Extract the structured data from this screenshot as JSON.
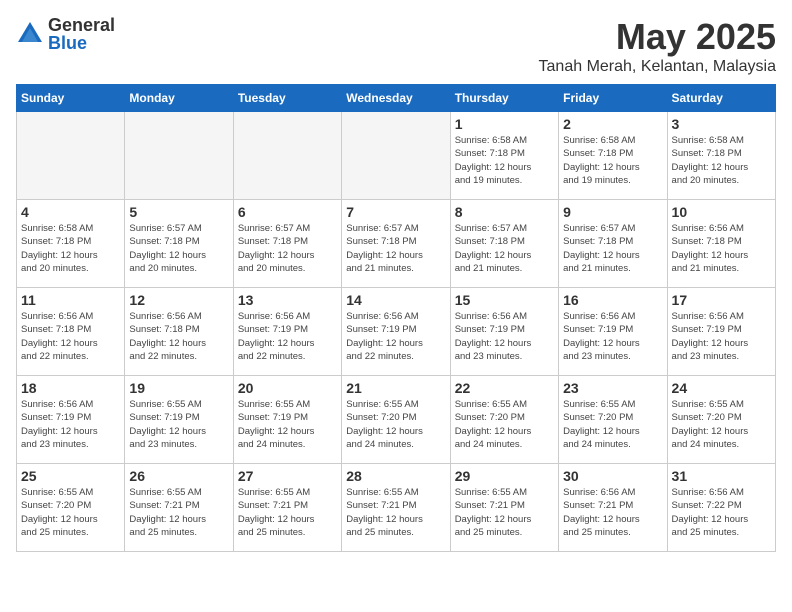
{
  "logo": {
    "general": "General",
    "blue": "Blue"
  },
  "title": "May 2025",
  "location": "Tanah Merah, Kelantan, Malaysia",
  "weekdays": [
    "Sunday",
    "Monday",
    "Tuesday",
    "Wednesday",
    "Thursday",
    "Friday",
    "Saturday"
  ],
  "weeks": [
    [
      {
        "day": "",
        "info": ""
      },
      {
        "day": "",
        "info": ""
      },
      {
        "day": "",
        "info": ""
      },
      {
        "day": "",
        "info": ""
      },
      {
        "day": "1",
        "info": "Sunrise: 6:58 AM\nSunset: 7:18 PM\nDaylight: 12 hours\nand 19 minutes."
      },
      {
        "day": "2",
        "info": "Sunrise: 6:58 AM\nSunset: 7:18 PM\nDaylight: 12 hours\nand 19 minutes."
      },
      {
        "day": "3",
        "info": "Sunrise: 6:58 AM\nSunset: 7:18 PM\nDaylight: 12 hours\nand 20 minutes."
      }
    ],
    [
      {
        "day": "4",
        "info": "Sunrise: 6:58 AM\nSunset: 7:18 PM\nDaylight: 12 hours\nand 20 minutes."
      },
      {
        "day": "5",
        "info": "Sunrise: 6:57 AM\nSunset: 7:18 PM\nDaylight: 12 hours\nand 20 minutes."
      },
      {
        "day": "6",
        "info": "Sunrise: 6:57 AM\nSunset: 7:18 PM\nDaylight: 12 hours\nand 20 minutes."
      },
      {
        "day": "7",
        "info": "Sunrise: 6:57 AM\nSunset: 7:18 PM\nDaylight: 12 hours\nand 21 minutes."
      },
      {
        "day": "8",
        "info": "Sunrise: 6:57 AM\nSunset: 7:18 PM\nDaylight: 12 hours\nand 21 minutes."
      },
      {
        "day": "9",
        "info": "Sunrise: 6:57 AM\nSunset: 7:18 PM\nDaylight: 12 hours\nand 21 minutes."
      },
      {
        "day": "10",
        "info": "Sunrise: 6:56 AM\nSunset: 7:18 PM\nDaylight: 12 hours\nand 21 minutes."
      }
    ],
    [
      {
        "day": "11",
        "info": "Sunrise: 6:56 AM\nSunset: 7:18 PM\nDaylight: 12 hours\nand 22 minutes."
      },
      {
        "day": "12",
        "info": "Sunrise: 6:56 AM\nSunset: 7:18 PM\nDaylight: 12 hours\nand 22 minutes."
      },
      {
        "day": "13",
        "info": "Sunrise: 6:56 AM\nSunset: 7:19 PM\nDaylight: 12 hours\nand 22 minutes."
      },
      {
        "day": "14",
        "info": "Sunrise: 6:56 AM\nSunset: 7:19 PM\nDaylight: 12 hours\nand 22 minutes."
      },
      {
        "day": "15",
        "info": "Sunrise: 6:56 AM\nSunset: 7:19 PM\nDaylight: 12 hours\nand 23 minutes."
      },
      {
        "day": "16",
        "info": "Sunrise: 6:56 AM\nSunset: 7:19 PM\nDaylight: 12 hours\nand 23 minutes."
      },
      {
        "day": "17",
        "info": "Sunrise: 6:56 AM\nSunset: 7:19 PM\nDaylight: 12 hours\nand 23 minutes."
      }
    ],
    [
      {
        "day": "18",
        "info": "Sunrise: 6:56 AM\nSunset: 7:19 PM\nDaylight: 12 hours\nand 23 minutes."
      },
      {
        "day": "19",
        "info": "Sunrise: 6:55 AM\nSunset: 7:19 PM\nDaylight: 12 hours\nand 23 minutes."
      },
      {
        "day": "20",
        "info": "Sunrise: 6:55 AM\nSunset: 7:19 PM\nDaylight: 12 hours\nand 24 minutes."
      },
      {
        "day": "21",
        "info": "Sunrise: 6:55 AM\nSunset: 7:20 PM\nDaylight: 12 hours\nand 24 minutes."
      },
      {
        "day": "22",
        "info": "Sunrise: 6:55 AM\nSunset: 7:20 PM\nDaylight: 12 hours\nand 24 minutes."
      },
      {
        "day": "23",
        "info": "Sunrise: 6:55 AM\nSunset: 7:20 PM\nDaylight: 12 hours\nand 24 minutes."
      },
      {
        "day": "24",
        "info": "Sunrise: 6:55 AM\nSunset: 7:20 PM\nDaylight: 12 hours\nand 24 minutes."
      }
    ],
    [
      {
        "day": "25",
        "info": "Sunrise: 6:55 AM\nSunset: 7:20 PM\nDaylight: 12 hours\nand 25 minutes."
      },
      {
        "day": "26",
        "info": "Sunrise: 6:55 AM\nSunset: 7:21 PM\nDaylight: 12 hours\nand 25 minutes."
      },
      {
        "day": "27",
        "info": "Sunrise: 6:55 AM\nSunset: 7:21 PM\nDaylight: 12 hours\nand 25 minutes."
      },
      {
        "day": "28",
        "info": "Sunrise: 6:55 AM\nSunset: 7:21 PM\nDaylight: 12 hours\nand 25 minutes."
      },
      {
        "day": "29",
        "info": "Sunrise: 6:55 AM\nSunset: 7:21 PM\nDaylight: 12 hours\nand 25 minutes."
      },
      {
        "day": "30",
        "info": "Sunrise: 6:56 AM\nSunset: 7:21 PM\nDaylight: 12 hours\nand 25 minutes."
      },
      {
        "day": "31",
        "info": "Sunrise: 6:56 AM\nSunset: 7:22 PM\nDaylight: 12 hours\nand 25 minutes."
      }
    ]
  ]
}
